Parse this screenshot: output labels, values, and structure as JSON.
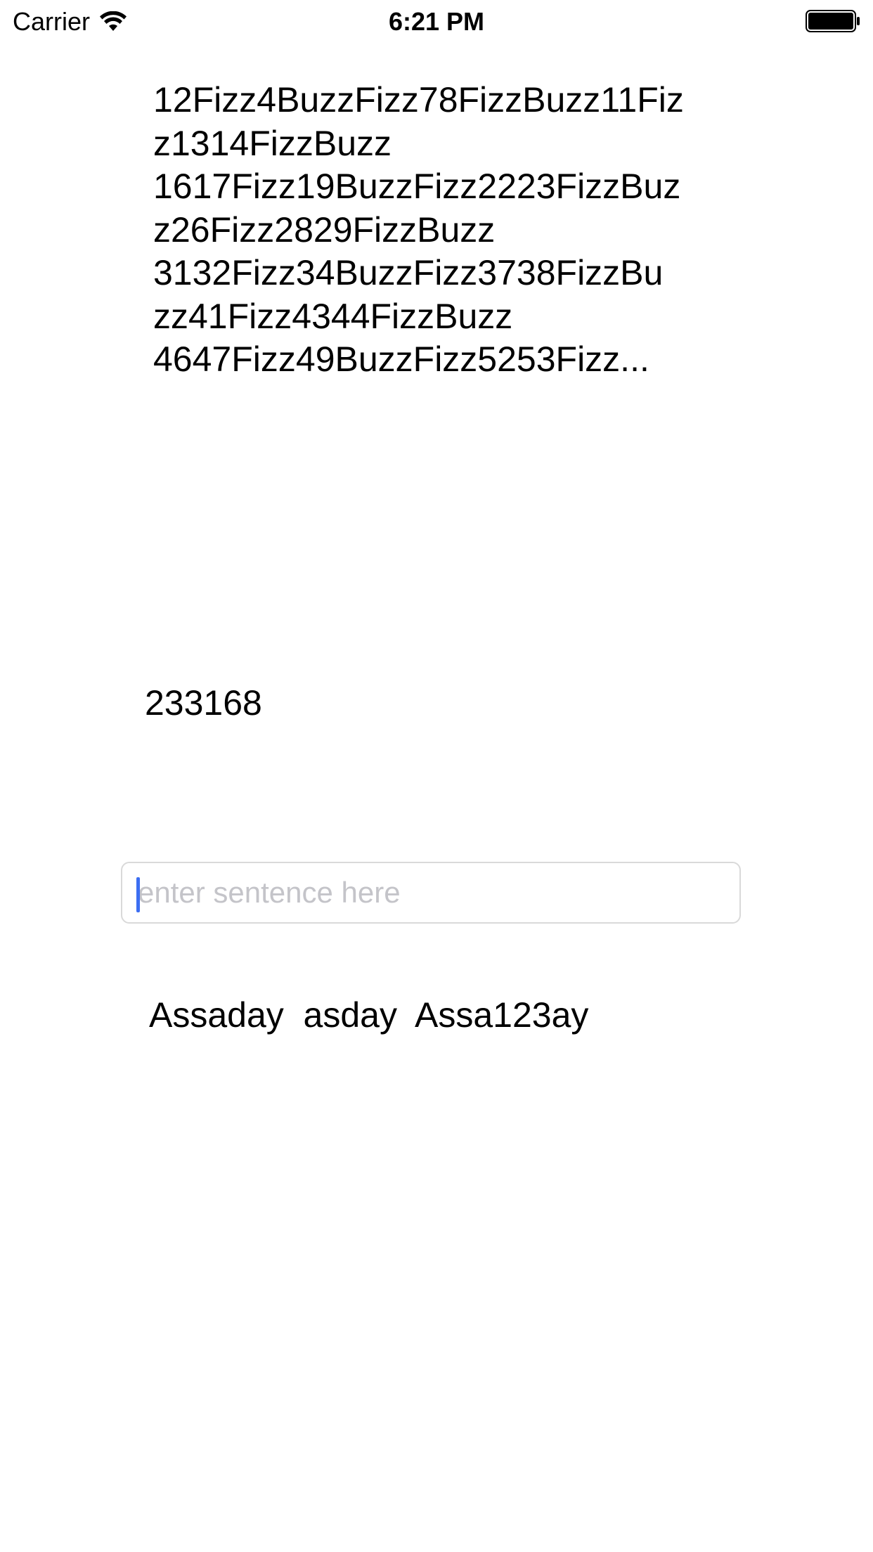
{
  "status_bar": {
    "carrier": "Carrier",
    "time": "6:21 PM",
    "icons": [
      "wifi-icon",
      "battery-icon"
    ]
  },
  "fizzbuzz": {
    "text": "12Fizz4BuzzFizz78FizzBuzz11Fiz\nz1314FizzBuzz\n1617Fizz19BuzzFizz2223FizzBuz\nz26Fizz2829FizzBuzz\n3132Fizz34BuzzFizz3738FizzBu\nzz41Fizz4344FizzBuzz\n4647Fizz49BuzzFizz5253Fizz..."
  },
  "sum": {
    "value": "233168"
  },
  "sentence_input": {
    "value": "",
    "placeholder": "enter sentence here"
  },
  "pig_latin": {
    "output": "Assaday  asday  Assa123ay"
  },
  "colors": {
    "caret": "#3c6ef2",
    "placeholder": "#c4c4c9",
    "field_border": "#d9d9d9"
  }
}
